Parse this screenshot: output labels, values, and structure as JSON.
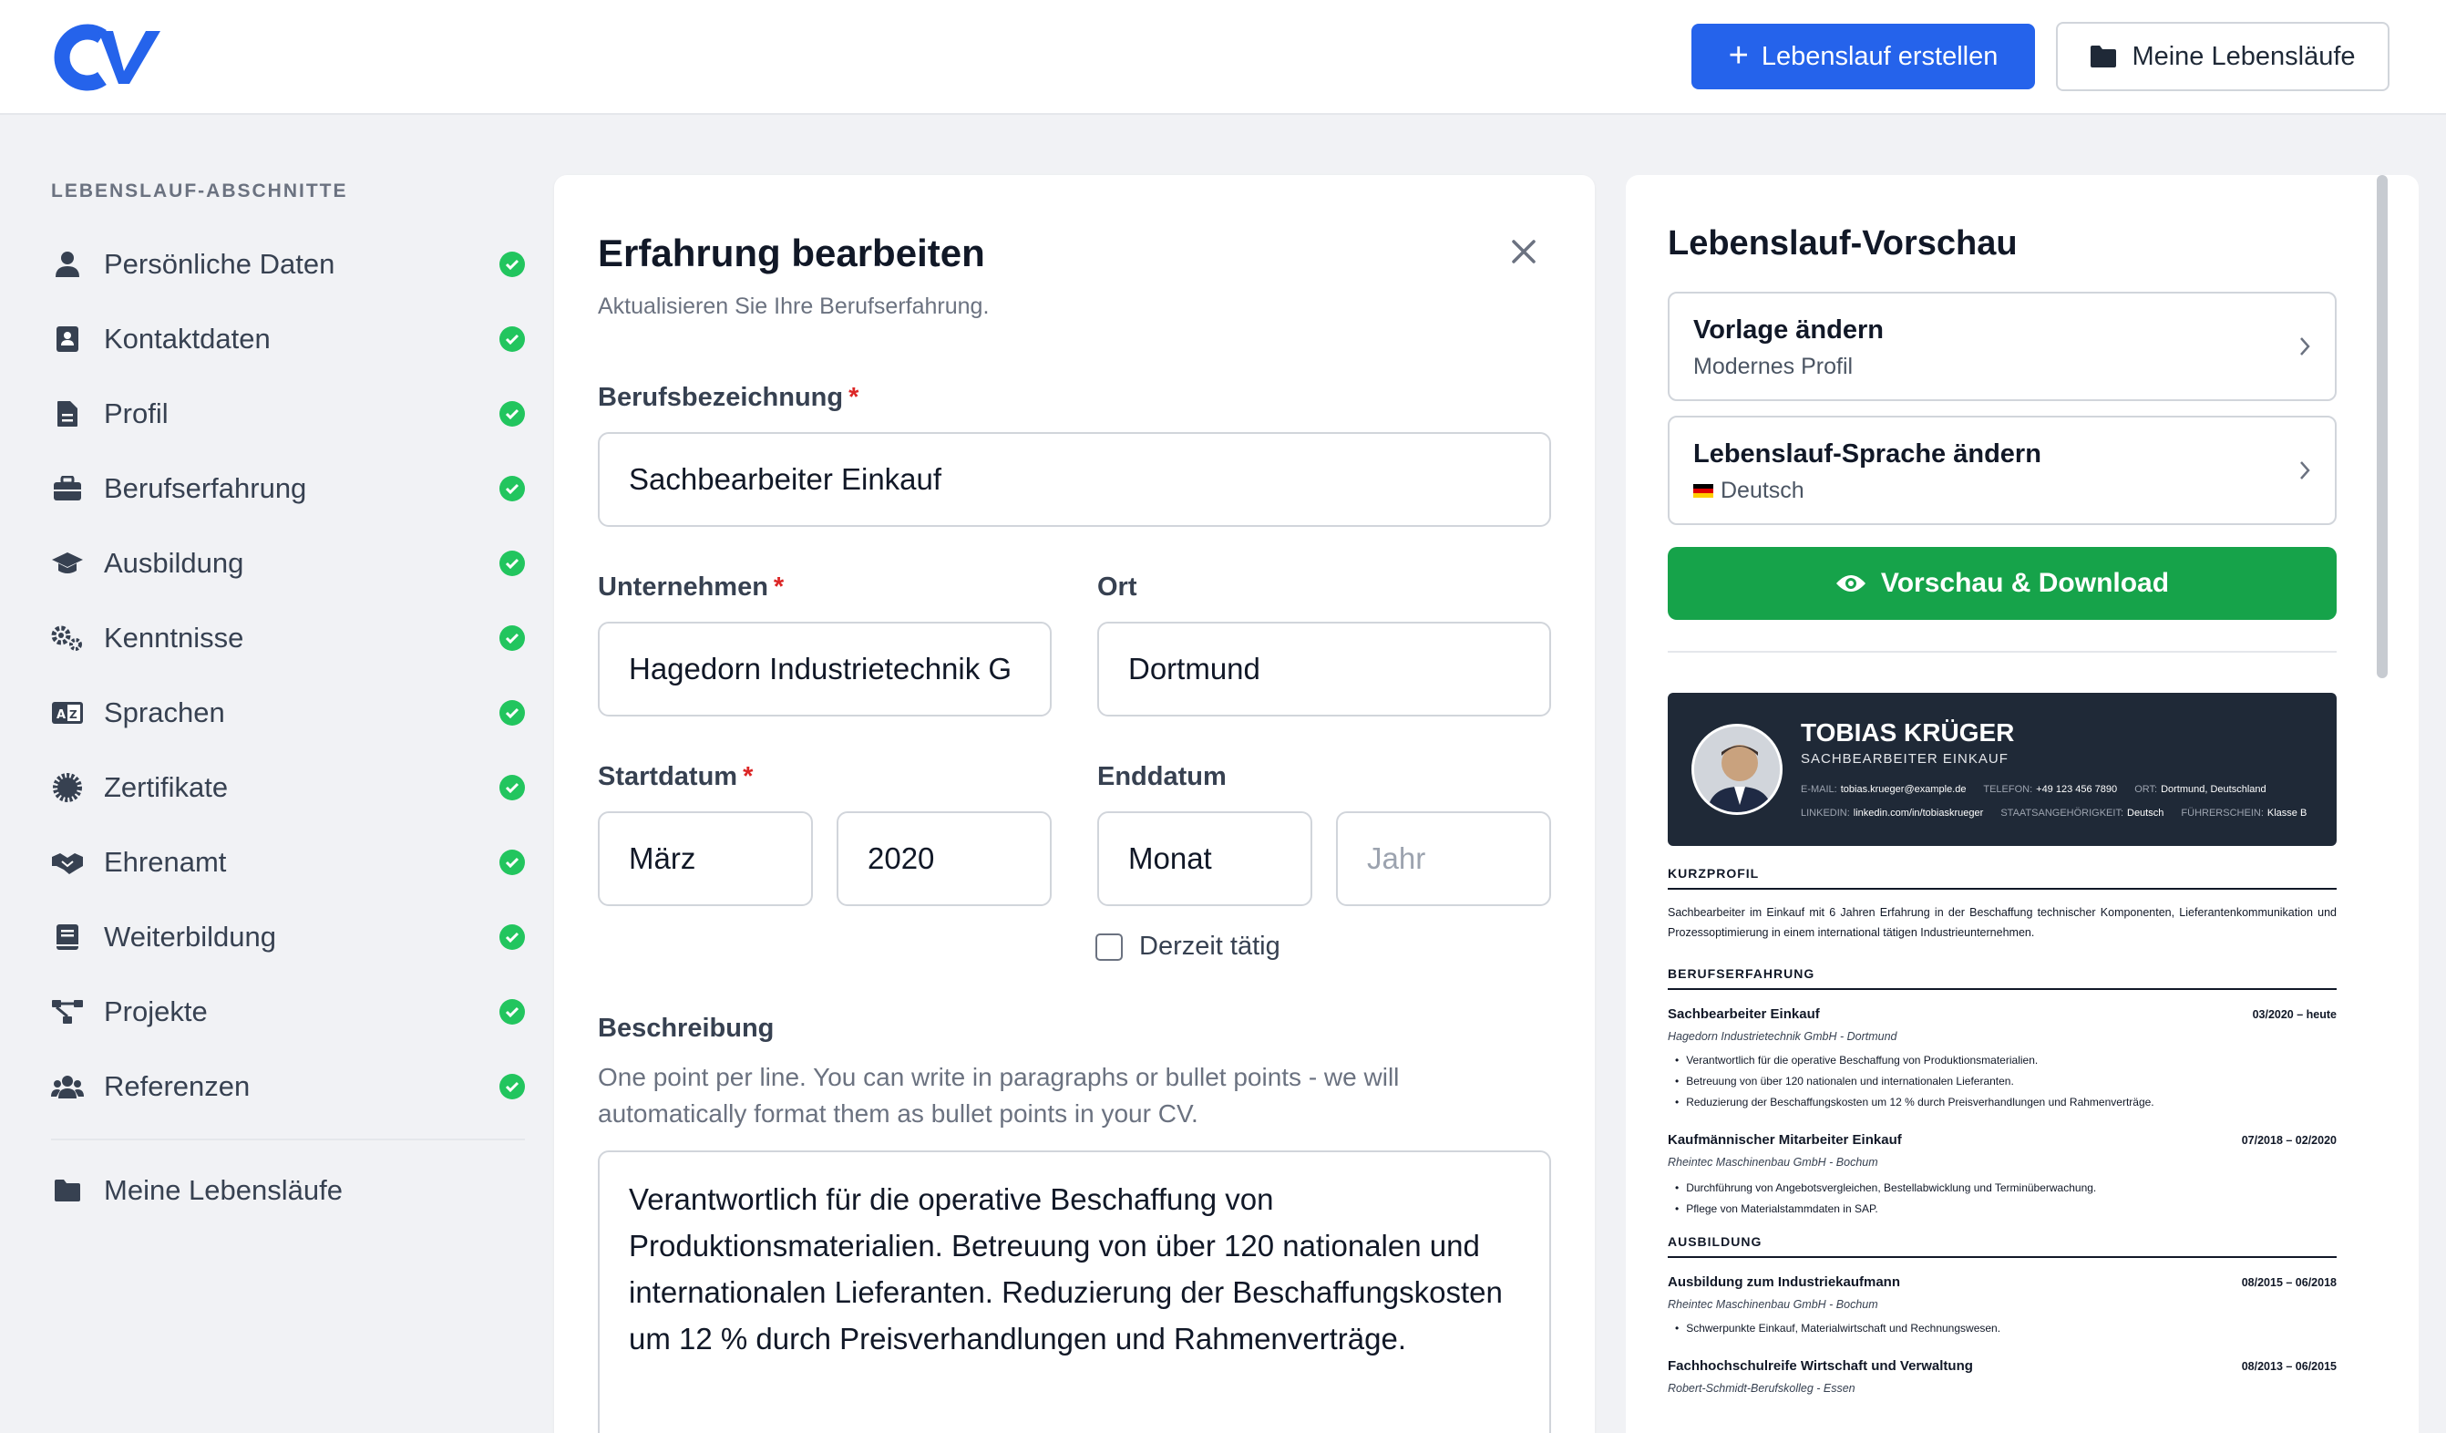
{
  "header": {
    "create_label": "Lebenslauf erstellen",
    "my_cvs_label": "Meine Lebensläufe",
    "brand_color": "#2563eb"
  },
  "sidebar": {
    "heading": "LEBENSLAUF-ABSCHNITTE",
    "items": [
      {
        "label": "Persönliche Daten",
        "icon": "user-icon",
        "complete": true
      },
      {
        "label": "Kontaktdaten",
        "icon": "contact-card-icon",
        "complete": true
      },
      {
        "label": "Profil",
        "icon": "document-icon",
        "complete": true
      },
      {
        "label": "Berufserfahrung",
        "icon": "briefcase-icon",
        "complete": true
      },
      {
        "label": "Ausbildung",
        "icon": "graduation-cap-icon",
        "complete": true
      },
      {
        "label": "Kenntnisse",
        "icon": "gears-icon",
        "complete": true
      },
      {
        "label": "Sprachen",
        "icon": "language-icon",
        "complete": true
      },
      {
        "label": "Zertifikate",
        "icon": "certificate-icon",
        "complete": true
      },
      {
        "label": "Ehrenamt",
        "icon": "handshake-icon",
        "complete": true
      },
      {
        "label": "Weiterbildung",
        "icon": "book-icon",
        "complete": true
      },
      {
        "label": "Projekte",
        "icon": "diagram-icon",
        "complete": true
      },
      {
        "label": "Referenzen",
        "icon": "users-icon",
        "complete": true
      }
    ],
    "my_cvs_label": "Meine Lebensläufe"
  },
  "editor": {
    "title": "Erfahrung bearbeiten",
    "subtitle": "Aktualisieren Sie Ihre Berufserfahrung.",
    "job_title_label": "Berufsbezeichnung",
    "job_title_value": "Sachbearbeiter Einkauf",
    "company_label": "Unternehmen",
    "company_value": "Hagedorn Industrietechnik G",
    "location_label": "Ort",
    "location_value": "Dortmund",
    "start_label": "Startdatum",
    "start_month": "März",
    "start_year": "2020",
    "end_label": "Enddatum",
    "end_month": "Monat",
    "end_year_placeholder": "Jahr",
    "current_label": "Derzeit tätig",
    "current_checked": false,
    "description_label": "Beschreibung",
    "description_hint": "One point per line. You can write in paragraphs or bullet points - we will automatically format them as bullet points in your CV.",
    "description_value": "Verantwortlich für die operative Beschaffung von Produktionsmaterialien. Betreuung von über 120 nationalen und internationalen Lieferanten. Reduzierung der Beschaffungskosten um 12 % durch Preisverhandlungen und Rahmenverträge."
  },
  "preview": {
    "title": "Lebenslauf-Vorschau",
    "template_title": "Vorlage ändern",
    "template_value": "Modernes Profil",
    "language_title": "Lebenslauf-Sprache ändern",
    "language_value": "Deutsch",
    "download_label": "Vorschau & Download",
    "download_color": "#16a34a",
    "cv": {
      "name": "TOBIAS KRÜGER",
      "role": "SACHBEARBEITER EINKAUF",
      "email_k": "E-MAIL:",
      "email_v": "tobias.krueger@example.de",
      "phone_k": "TELEFON:",
      "phone_v": "+49 123 456 7890",
      "loc_k": "ORT:",
      "loc_v": "Dortmund, Deutschland",
      "li_k": "LINKEDIN:",
      "li_v": "linkedin.com/in/tobiaskrueger",
      "nat_k": "STAATSANGEHÖRIGKEIT:",
      "nat_v": "Deutsch",
      "dl_k": "FÜHRERSCHEIN:",
      "dl_v": "Klasse B",
      "profile_heading": "KURZPROFIL",
      "profile_text": "Sachbearbeiter im Einkauf mit 6 Jahren Erfahrung in der Beschaffung technischer Komponenten, Lieferantenkommunikation und Prozessoptimierung in einem international tätigen Industrieunternehmen.",
      "exp_heading": "BERUFSERFAHRUNG",
      "job1_title": "Sachbearbeiter Einkauf",
      "job1_date": "03/2020 – heute",
      "job1_company": "Hagedorn Industrietechnik GmbH - Dortmund",
      "job1_b1": "Verantwortlich für die operative Beschaffung von Produktionsmaterialien.",
      "job1_b2": "Betreuung von über 120 nationalen und internationalen Lieferanten.",
      "job1_b3": "Reduzierung der Beschaffungskosten um 12 % durch Preisverhandlungen und Rahmenverträge.",
      "job2_title": "Kaufmännischer Mitarbeiter Einkauf",
      "job2_date": "07/2018 – 02/2020",
      "job2_company": "Rheintec Maschinenbau GmbH - Bochum",
      "job2_b1": "Durchführung von Angebotsvergleichen, Bestellabwicklung und Terminüberwachung.",
      "job2_b2": "Pflege von Materialstammdaten in SAP.",
      "edu_heading": "AUSBILDUNG",
      "edu1_title": "Ausbildung zum Industriekaufmann",
      "edu1_date": "08/2015 – 06/2018",
      "edu1_company": "Rheintec Maschinenbau GmbH - Bochum",
      "edu1_b1": "Schwerpunkte Einkauf, Materialwirtschaft und Rechnungswesen.",
      "edu2_title": "Fachhochschulreife Wirtschaft und Verwaltung",
      "edu2_date": "08/2013 – 06/2015",
      "edu2_company": "Robert-Schmidt-Berufskolleg - Essen"
    }
  }
}
